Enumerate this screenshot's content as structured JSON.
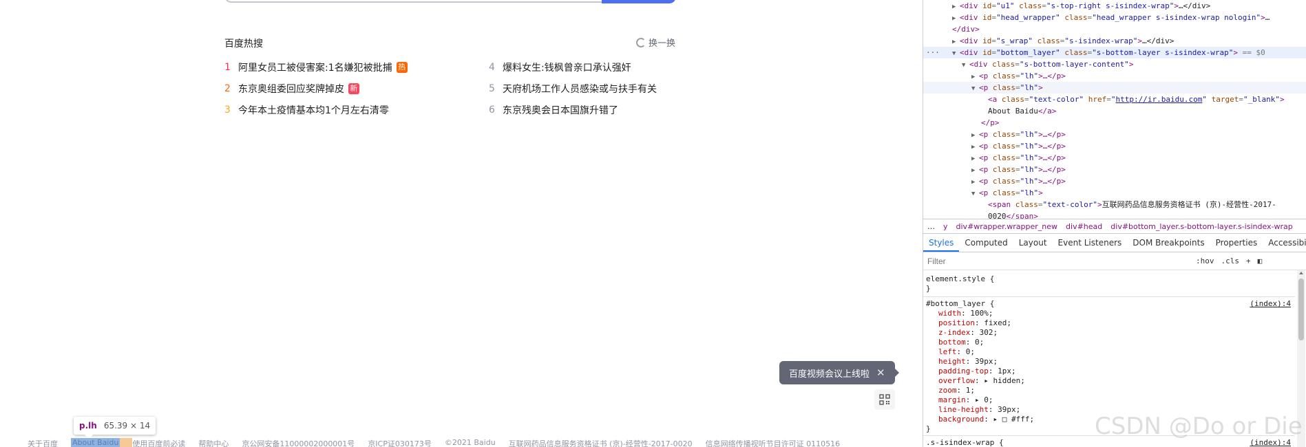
{
  "hot": {
    "title": "百度热搜",
    "refresh_label": "换一换",
    "items": [
      {
        "index": "1",
        "text": "阿里女员工被侵害案:1名嫌犯被批捕",
        "badge": "热"
      },
      {
        "index": "2",
        "text": "东京奥组委回应奖牌掉皮",
        "badge": "新"
      },
      {
        "index": "3",
        "text": "今年本土疫情基本均1个月左右清零",
        "badge": ""
      },
      {
        "index": "4",
        "text": "爆料女生:钱枫曾亲口承认强奸",
        "badge": ""
      },
      {
        "index": "5",
        "text": "天府机场工作人员感染或与扶手有关",
        "badge": ""
      },
      {
        "index": "6",
        "text": "东京残奥会日本国旗升错了",
        "badge": ""
      }
    ]
  },
  "toast": {
    "text": "百度视频会议上线啦",
    "close": "✕"
  },
  "tooltip": {
    "tag": "p.lh",
    "size": "65.39 × 14"
  },
  "footer": {
    "items": [
      "关于百度",
      "About Baidu",
      "使用百度前必读",
      "帮助中心",
      "京公网安备11000002000001号",
      "京ICP证030173号",
      "©2021 Baidu",
      "互联网药品信息服务资格证书 (京)-经营性-2017-0020",
      "信息网络传播视听节目许可证 0110516"
    ]
  },
  "devtools": {
    "elements": [
      {
        "tag": "div",
        "id": "u1",
        "cls": "s-top-right s-isindex-wrap",
        "tail": "…</div>"
      },
      {
        "tag": "div",
        "id": "head_wrapper",
        "cls": "head_wrapper s-isindex-wrap nologin",
        "tail": "…"
      },
      {
        "close": "</div>"
      },
      {
        "tag": "div",
        "id": "s_wrap",
        "cls": "s-isindex-wrap",
        "tail": "…</div>"
      },
      {
        "tag": "div",
        "id": "bottom_layer",
        "cls": "s-bottom-layer s-isindex-wrap",
        "tail": "== $0"
      },
      {
        "tag": "div",
        "cls": "s-bottom-layer-content"
      },
      {
        "p": "lh",
        "tail": "…</p>"
      },
      {
        "p": "lh"
      },
      {
        "a_cls": "text-color",
        "href": "http://ir.baidu.com",
        "target": "_blank"
      },
      {
        "text": "About Baidu",
        "closeTag": "</a>"
      },
      {
        "close": "</p>"
      },
      {
        "p": "lh",
        "tail": "…</p>"
      },
      {
        "p": "lh",
        "tail": "…</p>"
      },
      {
        "p": "lh",
        "tail": "…</p>"
      },
      {
        "p": "lh",
        "tail": "…</p>"
      },
      {
        "p": "lh",
        "tail": "…</p>"
      },
      {
        "p": "lh"
      },
      {
        "span_cls": "text-color",
        "span_text": "互联网药品信息服务资格证书 (京)-经营性-2017-"
      },
      {
        "text": "0020",
        "closeTag": "</span>"
      }
    ],
    "breadcrumbs": [
      "…",
      "y",
      "div#wrapper.wrapper_new",
      "div#head",
      "div#bottom_layer.s-bottom-layer.s-isindex-wrap"
    ],
    "tabs": [
      "Styles",
      "Computed",
      "Layout",
      "Event Listeners",
      "DOM Breakpoints",
      "Properties",
      "Accessibility"
    ],
    "filter_placeholder": "Filter",
    "filter_tools": [
      ":hov",
      ".cls",
      "+"
    ],
    "styles": {
      "element_style": "element.style {",
      "rule_selector": "#bottom_layer {",
      "rule_source": "(index):4",
      "props": [
        {
          "name": "width",
          "value": "100%;"
        },
        {
          "name": "position",
          "value": "fixed;"
        },
        {
          "name": "z-index",
          "value": "302;"
        },
        {
          "name": "bottom",
          "value": "0;"
        },
        {
          "name": "left",
          "value": "0;"
        },
        {
          "name": "height",
          "value": "39px;"
        },
        {
          "name": "padding-top",
          "value": "1px;"
        },
        {
          "name": "overflow",
          "value": "▸ hidden;"
        },
        {
          "name": "zoom",
          "value": "1;"
        },
        {
          "name": "margin",
          "value": "▸ 0;"
        },
        {
          "name": "line-height",
          "value": "39px;"
        },
        {
          "name": "background",
          "value": "▸ □ #fff;"
        }
      ],
      "close": "}",
      "next_selector": ".s-isindex-wrap {",
      "next_source": "(index):4"
    }
  },
  "watermark": "CSDN @Do or Die next"
}
